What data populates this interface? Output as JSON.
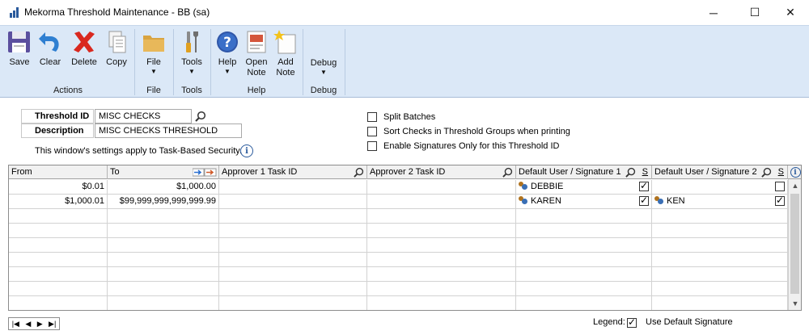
{
  "window": {
    "title": "Mekorma Threshold Maintenance  -  BB (sa)",
    "minimize_glyph": "─",
    "maximize_glyph": "☐",
    "close_glyph": "✕"
  },
  "ribbon": {
    "groups": [
      {
        "label": "Actions",
        "buttons": [
          {
            "label": "Save",
            "icon": "save-icon"
          },
          {
            "label": "Clear",
            "icon": "clear-icon"
          },
          {
            "label": "Delete",
            "icon": "delete-icon"
          },
          {
            "label": "Copy",
            "icon": "copy-icon"
          }
        ]
      },
      {
        "label": "File",
        "buttons": [
          {
            "label": "File",
            "icon": "folder-icon",
            "caret": "▼"
          }
        ]
      },
      {
        "label": "Tools",
        "buttons": [
          {
            "label": "Tools",
            "icon": "tools-icon",
            "caret": "▼"
          }
        ]
      },
      {
        "label": "Help",
        "buttons": [
          {
            "label": "Help",
            "icon": "help-icon",
            "caret": "▼"
          },
          {
            "label": "Open Note",
            "line1": "Open",
            "line2": "Note",
            "icon": "open-note-icon"
          },
          {
            "label": "Add Note",
            "line1": "Add",
            "line2": "Note",
            "icon": "add-note-icon"
          }
        ]
      },
      {
        "label": "Debug",
        "buttons": [
          {
            "label": "Debug",
            "icon": "debug-icon",
            "caret": "▼"
          }
        ]
      }
    ]
  },
  "form": {
    "threshold_id_label": "Threshold ID",
    "threshold_id_value": "MISC CHECKS",
    "description_label": "Description",
    "description_value": "MISC CHECKS THRESHOLD",
    "security_note": "This window's settings apply to Task-Based Security.",
    "info_glyph": "i",
    "options": [
      {
        "label": "Split Batches",
        "checked": false
      },
      {
        "label": "Sort Checks in Threshold Groups when printing",
        "checked": false
      },
      {
        "label": "Enable Signatures Only for this Threshold ID",
        "checked": false
      }
    ]
  },
  "grid": {
    "headers": {
      "from": "From",
      "to": "To",
      "approver1": "Approver 1 Task ID",
      "approver2": "Approver 2 Task ID",
      "default_user1": "Default User / Signature 1",
      "s1": "S",
      "default_user2": "Default User / Signature 2",
      "s2": "S"
    },
    "rows": [
      {
        "from": "$0.01",
        "to": "$1,000.00",
        "approver1": "",
        "approver2": "",
        "user1": "DEBBIE",
        "s1": true,
        "user2": "",
        "s2": false
      },
      {
        "from": "$1,000.01",
        "to": "$99,999,999,999,999.99",
        "approver1": "",
        "approver2": "",
        "user1": "KAREN",
        "s1": true,
        "user2": "KEN",
        "s2": true
      }
    ],
    "empty_rows": 7,
    "scroll_up_glyph": "▲",
    "scroll_down_glyph": "▼"
  },
  "footer": {
    "nav": {
      "first": "|◀",
      "prev": "◀",
      "next": "▶",
      "last": "▶|"
    },
    "legend_label": "Legend:",
    "legend_text": "Use Default Signature"
  },
  "colors": {
    "ribbon_bg": "#dbe8f7",
    "accent": "#2a5a9c",
    "delete_red": "#d9281f"
  }
}
